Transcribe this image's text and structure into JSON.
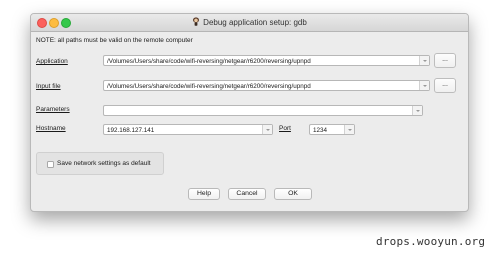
{
  "window": {
    "title": "Debug application setup: gdb"
  },
  "note": "NOTE: all paths must be valid on the remote computer",
  "application": {
    "label": "Application",
    "value": "/Volumes/Users/share/code/wifi-reversing/netgear/r6200/reversing/upnpd",
    "browse_label": "..."
  },
  "input_file": {
    "label": "Input file",
    "value": "/Volumes/Users/share/code/wifi-reversing/netgear/r6200/reversing/upnpd",
    "browse_label": "..."
  },
  "parameters": {
    "label": "Parameters",
    "value": ""
  },
  "hostname": {
    "label": "Hostname",
    "value": "192.168.127.141"
  },
  "port": {
    "label": "Port",
    "value": "1234"
  },
  "save_settings": {
    "label": "Save network settings as default",
    "checked": false
  },
  "buttons": {
    "help": "Help",
    "cancel": "Cancel",
    "ok": "OK"
  },
  "watermark": "drops.wooyun.org"
}
